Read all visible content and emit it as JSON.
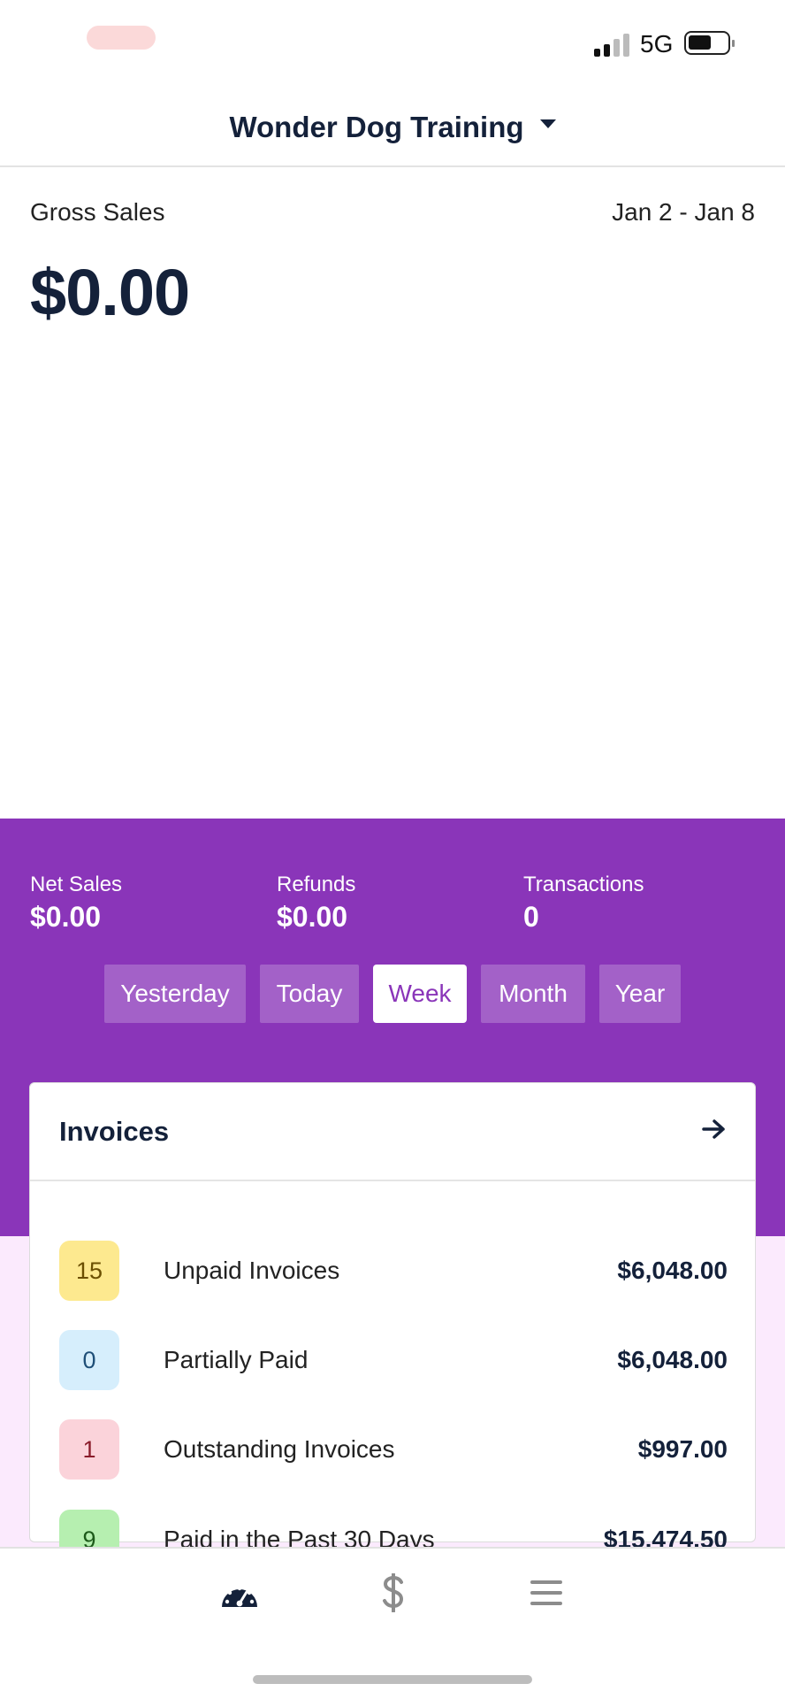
{
  "status_bar": {
    "carrier": "5G"
  },
  "header": {
    "title": "Wonder Dog Training"
  },
  "summary": {
    "gross_label": "Gross Sales",
    "date_range": "Jan 2 - Jan 8",
    "gross_value": "$0.00"
  },
  "stats": [
    {
      "label": "Net Sales",
      "value": "$0.00"
    },
    {
      "label": "Refunds",
      "value": "$0.00"
    },
    {
      "label": "Transactions",
      "value": "0"
    }
  ],
  "periods": {
    "items": [
      "Yesterday",
      "Today",
      "Week",
      "Month",
      "Year"
    ],
    "selected": "Week"
  },
  "invoices": {
    "title": "Invoices",
    "rows": [
      {
        "count": "15",
        "label": "Unpaid Invoices",
        "amount": "$6,048.00"
      },
      {
        "count": "0",
        "label": "Partially Paid",
        "amount": "$6,048.00"
      },
      {
        "count": "1",
        "label": "Outstanding Invoices",
        "amount": "$997.00"
      },
      {
        "count": "9",
        "label": "Paid in the Past 30 Days",
        "amount": "$15,474.50"
      }
    ]
  },
  "tabbar": {
    "tabs": [
      {
        "icon": "dashboard-icon",
        "active": true
      },
      {
        "icon": "dollar-icon",
        "active": false
      },
      {
        "icon": "menu-icon",
        "active": false
      }
    ]
  },
  "colors": {
    "accent": "#8a35b9",
    "navy": "#14213a",
    "badge_yellow": "#fde98f",
    "badge_blue": "#d6eefc",
    "badge_red": "#fbd3da",
    "badge_green": "#b6efb0"
  }
}
